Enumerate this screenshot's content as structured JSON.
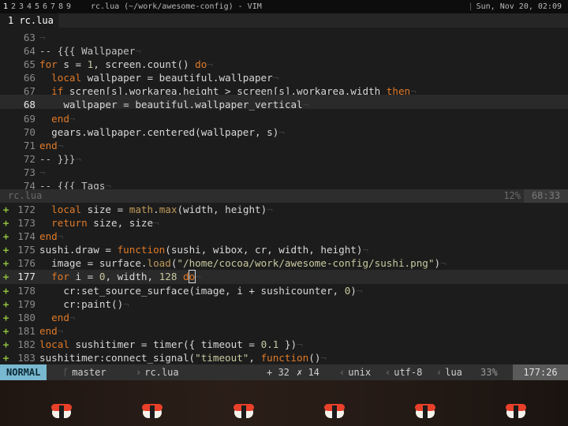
{
  "wibox": {
    "tags": [
      "1",
      "2",
      "3",
      "4",
      "5",
      "6",
      "7",
      "8",
      "9"
    ],
    "window_title": "rc.lua (~/work/awesome-config) - VIM",
    "separator": "|",
    "clock": "Sun, Nov 20, 02:09"
  },
  "tabline": {
    "tab_label": "1 rc.lua"
  },
  "pane1": {
    "lines": [
      {
        "n": "63",
        "text": "",
        "eol": "¬"
      },
      {
        "n": "64",
        "text": "-- {{{ Wallpaper",
        "eol": "¬"
      },
      {
        "n": "65",
        "text": "for s = 1, screen.count() do",
        "eol": "¬"
      },
      {
        "n": "66",
        "text": "  local wallpaper = beautiful.wallpaper",
        "eol": "¬"
      },
      {
        "n": "67",
        "text": "  if screen[s].workarea.height > screen[s].workarea.width then",
        "eol": "¬"
      },
      {
        "n": "68",
        "text": "    wallpaper = beautiful.wallpaper_vertical",
        "eol": "¬",
        "current": true
      },
      {
        "n": "69",
        "text": "  end",
        "eol": "¬"
      },
      {
        "n": "70",
        "text": "  gears.wallpaper.centered(wallpaper, s)",
        "eol": "¬"
      },
      {
        "n": "71",
        "text": "end",
        "eol": "¬"
      },
      {
        "n": "72",
        "text": "-- }}}",
        "eol": "¬"
      },
      {
        "n": "73",
        "text": "",
        "eol": "¬"
      },
      {
        "n": "74",
        "text": "-- {{{ Tags",
        "eol": "¬"
      }
    ],
    "status": {
      "filename": "rc.lua",
      "percent": "12%",
      "position": "68:33"
    }
  },
  "pane2": {
    "sign": "+",
    "lines": [
      {
        "n": "172",
        "text": "  local size = math.max(width, height)",
        "eol": "¬"
      },
      {
        "n": "173",
        "text": "  return size, size",
        "eol": "¬"
      },
      {
        "n": "174",
        "text": "end",
        "eol": "¬"
      },
      {
        "n": "175",
        "text": "sushi.draw = function(sushi, wibox, cr, width, height)",
        "eol": "¬"
      },
      {
        "n": "176",
        "text": "  image = surface.load(\"/home/cocoa/work/awesome-config/sushi.png\")",
        "eol": "¬"
      },
      {
        "n": "177",
        "text": "  for i = 0, width, 128 do",
        "eol": "¬",
        "current": true
      },
      {
        "n": "178",
        "text": "    cr:set_source_surface(image, i + sushicounter, 0)",
        "eol": "¬"
      },
      {
        "n": "179",
        "text": "    cr:paint()",
        "eol": "¬"
      },
      {
        "n": "180",
        "text": "  end",
        "eol": "¬"
      },
      {
        "n": "181",
        "text": "end",
        "eol": "¬"
      },
      {
        "n": "182",
        "text": "local sushitimer = timer({ timeout = 0.1 })",
        "eol": "¬"
      },
      {
        "n": "183",
        "text": "sushitimer:connect_signal(\"timeout\", function()",
        "eol": "¬"
      }
    ],
    "status": {
      "mode": "NORMAL",
      "branch_icon": "git-branch-icon",
      "branch": "master",
      "filename": "rc.lua",
      "added": "+ 32",
      "removed": "✗ 14",
      "fileformat": "unix",
      "encoding": "utf-8",
      "filetype": "lua",
      "percent": "33%",
      "position": "177:26"
    }
  },
  "colors": {
    "keyword": "#e07a28",
    "mode_bg": "#78b8d0",
    "sign": "#8ebf3f",
    "background": "#1c1c1c"
  }
}
